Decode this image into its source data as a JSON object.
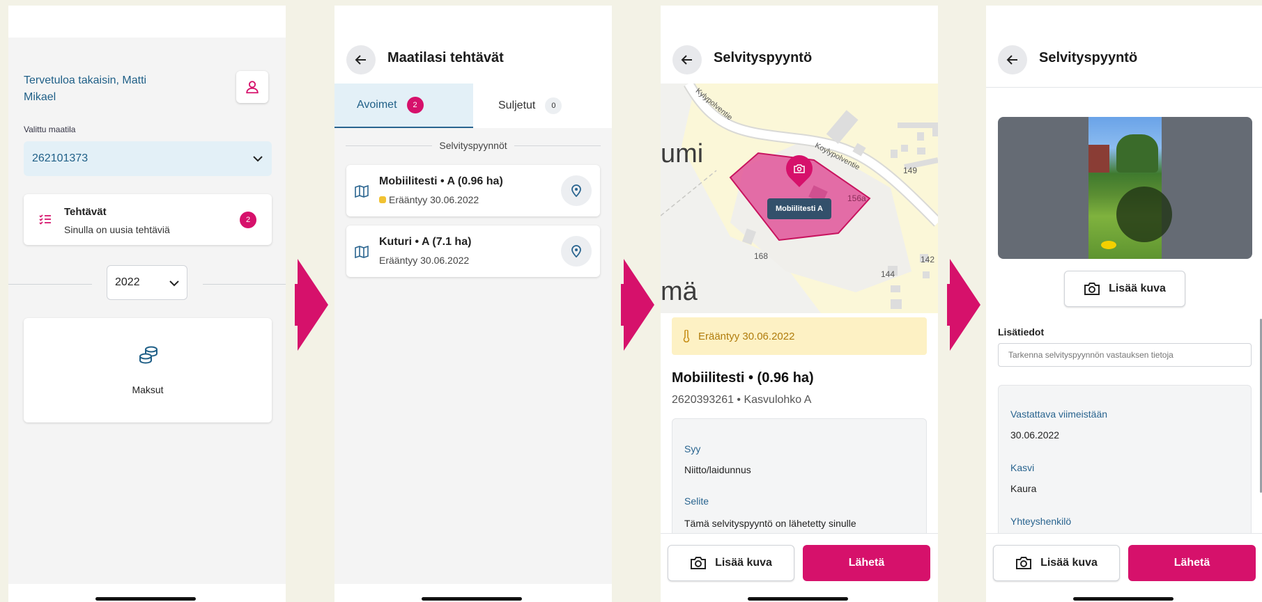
{
  "screen1": {
    "welcome": "Tervetuloa takaisin, Matti Mikael",
    "farm_label": "Valittu maatila",
    "farm_value": "262101373",
    "tasks_title": "Tehtävät",
    "tasks_subtitle": "Sinulla on uusia tehtäviä",
    "tasks_count": "2",
    "year": "2022",
    "payments_label": "Maksut"
  },
  "screen2": {
    "title": "Maatilasi tehtävät",
    "tabs": [
      {
        "label": "Avoimet",
        "count": "2"
      },
      {
        "label": "Suljetut",
        "count": "0"
      }
    ],
    "section_label": "Selvityspyynnöt",
    "items": [
      {
        "title": "Mobiilitesti • A (0.96 ha)",
        "due": "Erääntyy 30.06.2022"
      },
      {
        "title": "Kuturi • A (7.1 ha)",
        "due": "Erääntyy 30.06.2022"
      }
    ]
  },
  "screen3": {
    "title": "Selvityspyyntö",
    "map": {
      "road1": "Kylypolventie",
      "road2": "Koylypolventie",
      "place_partial1": "umi",
      "place_partial2": "mä",
      "house_numbers": [
        "149",
        "156a",
        "168",
        "142",
        "144"
      ],
      "parcel_label": "Mobiilitesti A"
    },
    "due_banner": "Erääntyy 30.06.2022",
    "heading": "Mobiilitesti • (0.96 ha)",
    "subheading": "2620393261 • Kasvulohko A",
    "reason_label": "Syy",
    "reason_value": "Niitto/laidunnus",
    "explanation_label": "Selite",
    "explanation_value": "Tämä selvityspyyntö on lähetetty sinulle",
    "add_photo": "Lisää kuva",
    "send": "Lähetä"
  },
  "screen4": {
    "title": "Selvityspyyntö",
    "add_photo_center": "Lisää kuva",
    "extra_label": "Lisätiedot",
    "extra_placeholder": "Tarkenna selvityspyynnön vastauksen tietoja",
    "deadline_label": "Vastattava viimeistään",
    "deadline_value": "30.06.2022",
    "crop_label": "Kasvi",
    "crop_value": "Kaura",
    "contact_label": "Yhteyshenkilö",
    "add_photo": "Lisää kuva",
    "send": "Lähetä"
  },
  "colors": {
    "accent": "#d6116b",
    "blue": "#29648f",
    "warning_bg": "#fdf1c4"
  }
}
